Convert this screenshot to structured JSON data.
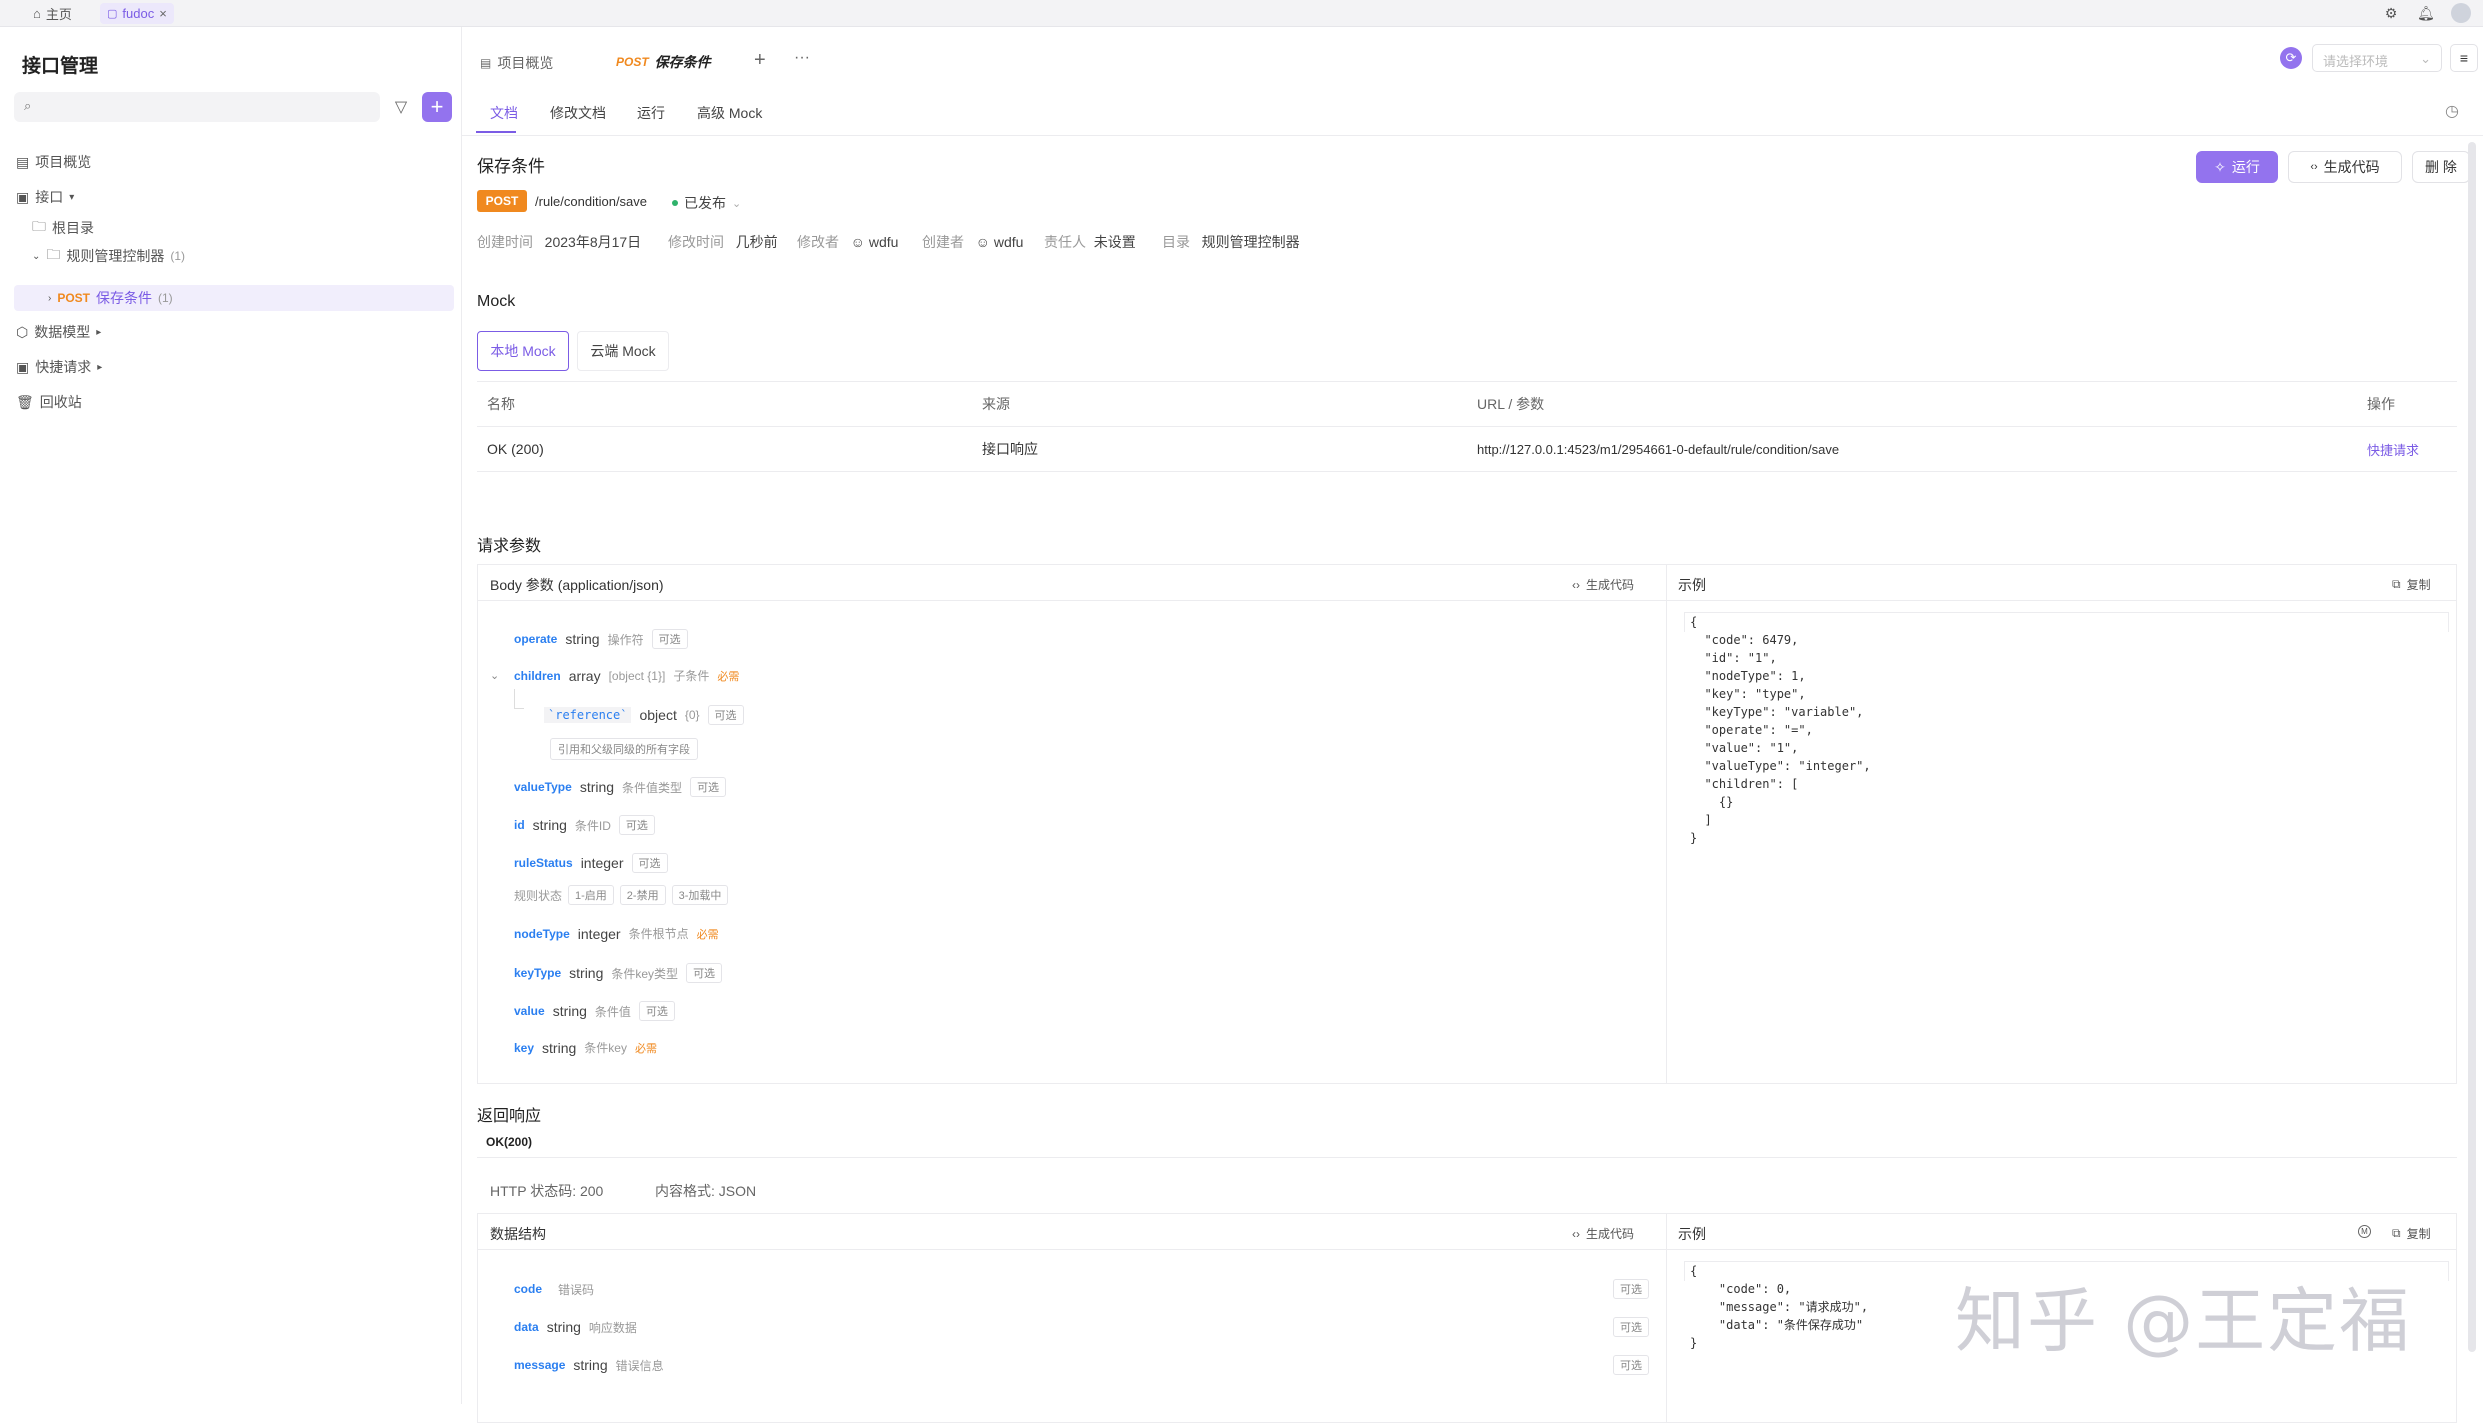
{
  "topbar": {
    "home_label": "主页",
    "doc_tab": "fudoc",
    "doc_tab_close": "×"
  },
  "sidebar": {
    "title": "接口管理",
    "items": [
      {
        "label": "项目概览"
      },
      {
        "label": "接口",
        "arrow": "▾"
      },
      {
        "label": "根目录"
      },
      {
        "label": "规则管理控制器",
        "count": "(1)"
      },
      {
        "method": "POST",
        "label": "保存条件",
        "count": "(1)"
      },
      {
        "label": "数据模型",
        "arrow": "▸"
      },
      {
        "label": "快捷请求",
        "arrow": "▸"
      },
      {
        "label": "回收站"
      }
    ]
  },
  "tabs": {
    "overview": "项目概览",
    "api_method": "POST",
    "api_name": "保存条件",
    "add": "+",
    "more": "···",
    "env_placeholder": "请选择环境"
  },
  "subtabs": [
    "文档",
    "修改文档",
    "运行",
    "高级 Mock"
  ],
  "api": {
    "title": "保存条件",
    "method": "POST",
    "path": "/rule/condition/save",
    "status": "已发布",
    "meta": [
      {
        "label": "创建时间",
        "value": "2023年8月17日"
      },
      {
        "label": "修改时间",
        "value": "几秒前"
      },
      {
        "label": "修改者",
        "value": "wdfu"
      },
      {
        "label": "创建者",
        "value": "wdfu"
      },
      {
        "label": "责任人",
        "value": "未设置"
      },
      {
        "label": "目录",
        "value": "规则管理控制器"
      }
    ],
    "actions": {
      "run": "运行",
      "gen_code": "生成代码",
      "delete": "删 除"
    }
  },
  "mock": {
    "heading": "Mock",
    "tabs": [
      "本地 Mock",
      "云端 Mock"
    ],
    "columns": [
      "名称",
      "来源",
      "URL / 参数",
      "操作"
    ],
    "rows": [
      {
        "name": "OK (200)",
        "source": "接口响应",
        "url": "http://127.0.0.1:4523/m1/2954661-0-default/rule/condition/save",
        "action": "快捷请求"
      }
    ]
  },
  "request": {
    "heading": "请求参数",
    "body_label": "Body 参数 (application/json)",
    "gen_code": "生成代码",
    "example_label": "示例",
    "copy": "复制",
    "fields": [
      {
        "name": "operate",
        "type": "string",
        "desc": "操作符",
        "flag": "可选"
      },
      {
        "name": "children",
        "type": "array",
        "type_detail": "[object {1}]",
        "desc": "子条件",
        "flag": "必需"
      },
      {
        "name": "`reference`",
        "type": "object",
        "type_detail": "{0}",
        "flag": "可选",
        "note": "引用和父级同级的所有字段"
      },
      {
        "name": "valueType",
        "type": "string",
        "desc": "条件值类型",
        "flag": "可选"
      },
      {
        "name": "id",
        "type": "string",
        "desc": "条件ID",
        "flag": "可选"
      },
      {
        "name": "ruleStatus",
        "type": "integer",
        "flag": "可选",
        "enum_label": "规则状态",
        "enum": [
          "1-启用",
          "2-禁用",
          "3-加载中"
        ]
      },
      {
        "name": "nodeType",
        "type": "integer",
        "desc": "条件根节点",
        "flag": "必需"
      },
      {
        "name": "keyType",
        "type": "string",
        "desc": "条件key类型",
        "flag": "可选"
      },
      {
        "name": "value",
        "type": "string",
        "desc": "条件值",
        "flag": "可选"
      },
      {
        "name": "key",
        "type": "string",
        "desc": "条件key",
        "flag": "必需"
      }
    ],
    "example_lines": [
      "{",
      "  \"code\": 6479,",
      "  \"id\": \"1\",",
      "  \"nodeType\": 1,",
      "  \"key\": \"type\",",
      "  \"keyType\": \"variable\",",
      "  \"operate\": \"=\",",
      "  \"value\": \"1\",",
      "  \"valueType\": \"integer\",",
      "  \"children\": [",
      "    {}",
      "  ]",
      "}"
    ]
  },
  "response": {
    "heading": "返回响应",
    "status_tab": "OK(200)",
    "http_status": "HTTP 状态码: 200",
    "content_type": "内容格式: JSON",
    "structure_label": "数据结构",
    "gen_code": "生成代码",
    "example_label": "示例",
    "copy": "复制",
    "fields": [
      {
        "name": "code",
        "type": "",
        "desc": "错误码",
        "flag": "可选"
      },
      {
        "name": "data",
        "type": "string",
        "desc": "响应数据",
        "flag": "可选"
      },
      {
        "name": "message",
        "type": "string",
        "desc": "错误信息",
        "flag": "可选"
      }
    ],
    "example_lines": [
      "{",
      "    \"code\": 0,",
      "    \"message\": \"请求成功\",",
      "    \"data\": \"条件保存成功\"",
      "}"
    ]
  },
  "watermark": "知乎 @王定福",
  "colors": {
    "accent": "#9373ee",
    "post": "#f0891f",
    "field": "#2b7ff0"
  }
}
